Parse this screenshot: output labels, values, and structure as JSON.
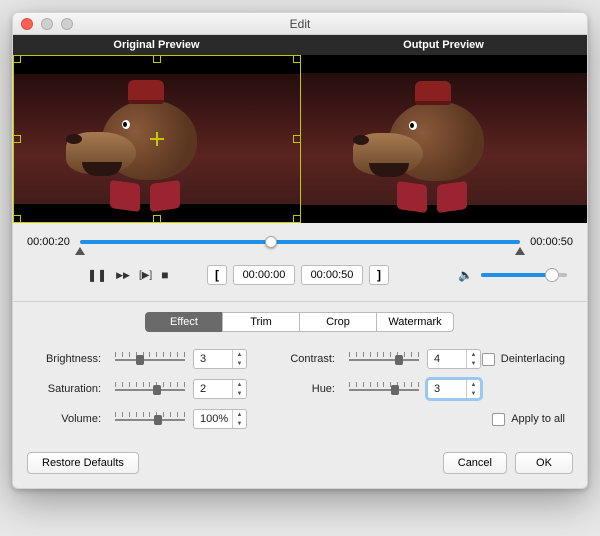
{
  "window": {
    "title": "Edit"
  },
  "traffic": {
    "close": "#ff5f57",
    "min": "#cfcfcf",
    "max": "#cfcfcf"
  },
  "previews": {
    "original_label": "Original Preview",
    "output_label": "Output Preview"
  },
  "timeline": {
    "start": "00:00:20",
    "end": "00:00:50",
    "thumb_pct": 42,
    "marker_start_pct": 0,
    "marker_end_pct": 100
  },
  "transport": {
    "pause_icon": "❚❚",
    "ff_icon": "▶▶",
    "step_icon": "[▶]",
    "stop_icon": "■",
    "bracket_in": "[",
    "bracket_out": "]",
    "in_time": "00:00:00",
    "out_time": "00:00:50",
    "volume_icon": "🔈",
    "volume_pct": 82
  },
  "tabs": {
    "items": [
      "Effect",
      "Trim",
      "Crop",
      "Watermark"
    ],
    "active": 0
  },
  "effects": {
    "brightness": {
      "label": "Brightness:",
      "value": "3",
      "knob_pct": 30
    },
    "contrast": {
      "label": "Contrast:",
      "value": "4",
      "knob_pct": 65
    },
    "saturation": {
      "label": "Saturation:",
      "value": "2",
      "knob_pct": 54
    },
    "hue": {
      "label": "Hue:",
      "value": "3",
      "knob_pct": 60
    },
    "volume": {
      "label": "Volume:",
      "value": "100%",
      "knob_pct": 55
    },
    "deinterlacing_label": "Deinterlacing",
    "apply_all_label": "Apply to all"
  },
  "buttons": {
    "restore": "Restore Defaults",
    "cancel": "Cancel",
    "ok": "OK"
  }
}
